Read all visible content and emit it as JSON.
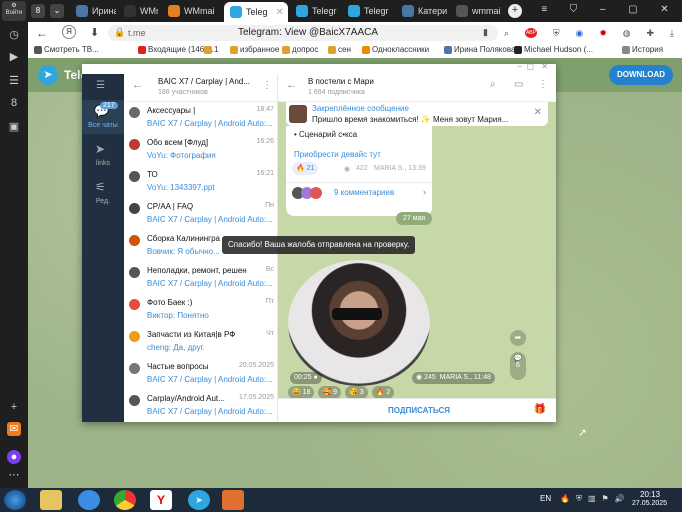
{
  "browser": {
    "tabs": [
      {
        "label": "Ирина",
        "icon_color": "#4a76a8"
      },
      {
        "label": "WMmai",
        "icon_color": "#333"
      },
      {
        "label": "WMmai",
        "icon_color": "#e67e22"
      },
      {
        "label": "Teleg",
        "icon_color": "#2ea6e0",
        "active": true
      },
      {
        "label": "Telegr",
        "icon_color": "#2ea6e0"
      },
      {
        "label": "Telegr",
        "icon_color": "#2ea6e0"
      },
      {
        "label": "Катери",
        "icon_color": "#4a76a8"
      },
      {
        "label": "wmmai",
        "icon_color": "#555"
      }
    ],
    "address_host": "t.me",
    "page_title": "Telegram: View @BaicX7AACA",
    "corner_label": "Войти",
    "bookmarks": [
      "Смотреть ТВ...",
      "Входящие (146)...",
      "1",
      "избранное",
      "допрос",
      "сен",
      "Одноклассники",
      "Ирина Полякова",
      "Michael Hudson (...",
      "История"
    ],
    "download_label": "DOWNLOAD",
    "tg_logo_label": "Teleg"
  },
  "folders": [
    {
      "label": "Все чаты",
      "badge": "217"
    },
    {
      "label": "links"
    },
    {
      "label": "Ред."
    }
  ],
  "chatlist": {
    "title": "BAIC X7 / Carplay | And...",
    "subtitle": "186 участников",
    "items": [
      {
        "name": "Аксессуары |",
        "time": "18:47",
        "msg": "BAIC X7 / Carplay | Android Auto:...",
        "avatar": "#6a6a6a"
      },
      {
        "name": "Обо всем [Флуд]",
        "time": "16:26",
        "sender": "VoYu:",
        "msg": "Фотография",
        "avatar": "#c0392b"
      },
      {
        "name": "ТО",
        "time": "16:21",
        "sender": "VoYu:",
        "msg": "1343397.ppt",
        "avatar": "#555"
      },
      {
        "name": "CP/AA | FAQ",
        "time": "Пн",
        "msg": "BAIC X7 / Carplay | Android Auto:...",
        "avatar": "#444"
      },
      {
        "name": "Сборка Калинингра",
        "time": "",
        "sender": "Вовчик:",
        "msg": "Я обычно...",
        "avatar": "#d35400"
      },
      {
        "name": "Неполадки, ремонт, решение",
        "time": "Вс",
        "msg": "BAIC X7 / Carplay | Android Auto:...",
        "avatar": "#555"
      },
      {
        "name": "Фото Баек :)",
        "time": "Пт",
        "sender": "Виктор:",
        "msg": "Понятно",
        "avatar": "#e74c3c"
      },
      {
        "name": "Запчасти из Китая|в РФ",
        "time": "Чт",
        "sender": "cheng:",
        "msg": "Да, друг.",
        "avatar": "#f39c12"
      },
      {
        "name": "Частые вопросы",
        "time": "20.05.2025",
        "msg": "BAIC X7 / Carplay | Android Auto:...",
        "avatar": "#777"
      },
      {
        "name": "Carplay/Android Aut...",
        "time": "17.05.2025",
        "msg": "BAIC X7 / Carplay | Android Auto:...",
        "avatar": "#555"
      }
    ]
  },
  "channel": {
    "title": "В постели с Мари",
    "subtitle": "1 694 подписчика",
    "pinned_title": "Закреплённое сообщение",
    "pinned_text": "Пришло время знакомиться! ✨ Меня зовут Мария...",
    "post_bullet": "• Сценарий с•кса",
    "post_link": "Приобрести девайс тут",
    "post_reaction": "21",
    "post_views": "422",
    "post_author": "MARIA S., 13:39",
    "comments": "9 комментариев",
    "date_chip": "27 мая",
    "toast": "Спасибо! Ваша жалоба отправлена на проверку.",
    "video_duration": "00:25",
    "video_views": "245",
    "video_author": "MARIA S., 11:48",
    "forward_count": "",
    "comment_count": "6",
    "reactions": [
      {
        "emoji": "😄",
        "count": "18"
      },
      {
        "emoji": "🥰",
        "count": "9"
      },
      {
        "emoji": "😘",
        "count": "3"
      },
      {
        "emoji": "🔥",
        "count": "2"
      }
    ],
    "subscribe_label": "ПОДПИСАТЬСЯ"
  },
  "taskbar": {
    "lang": "EN",
    "time": "20:13",
    "date": "27.05.2025"
  }
}
